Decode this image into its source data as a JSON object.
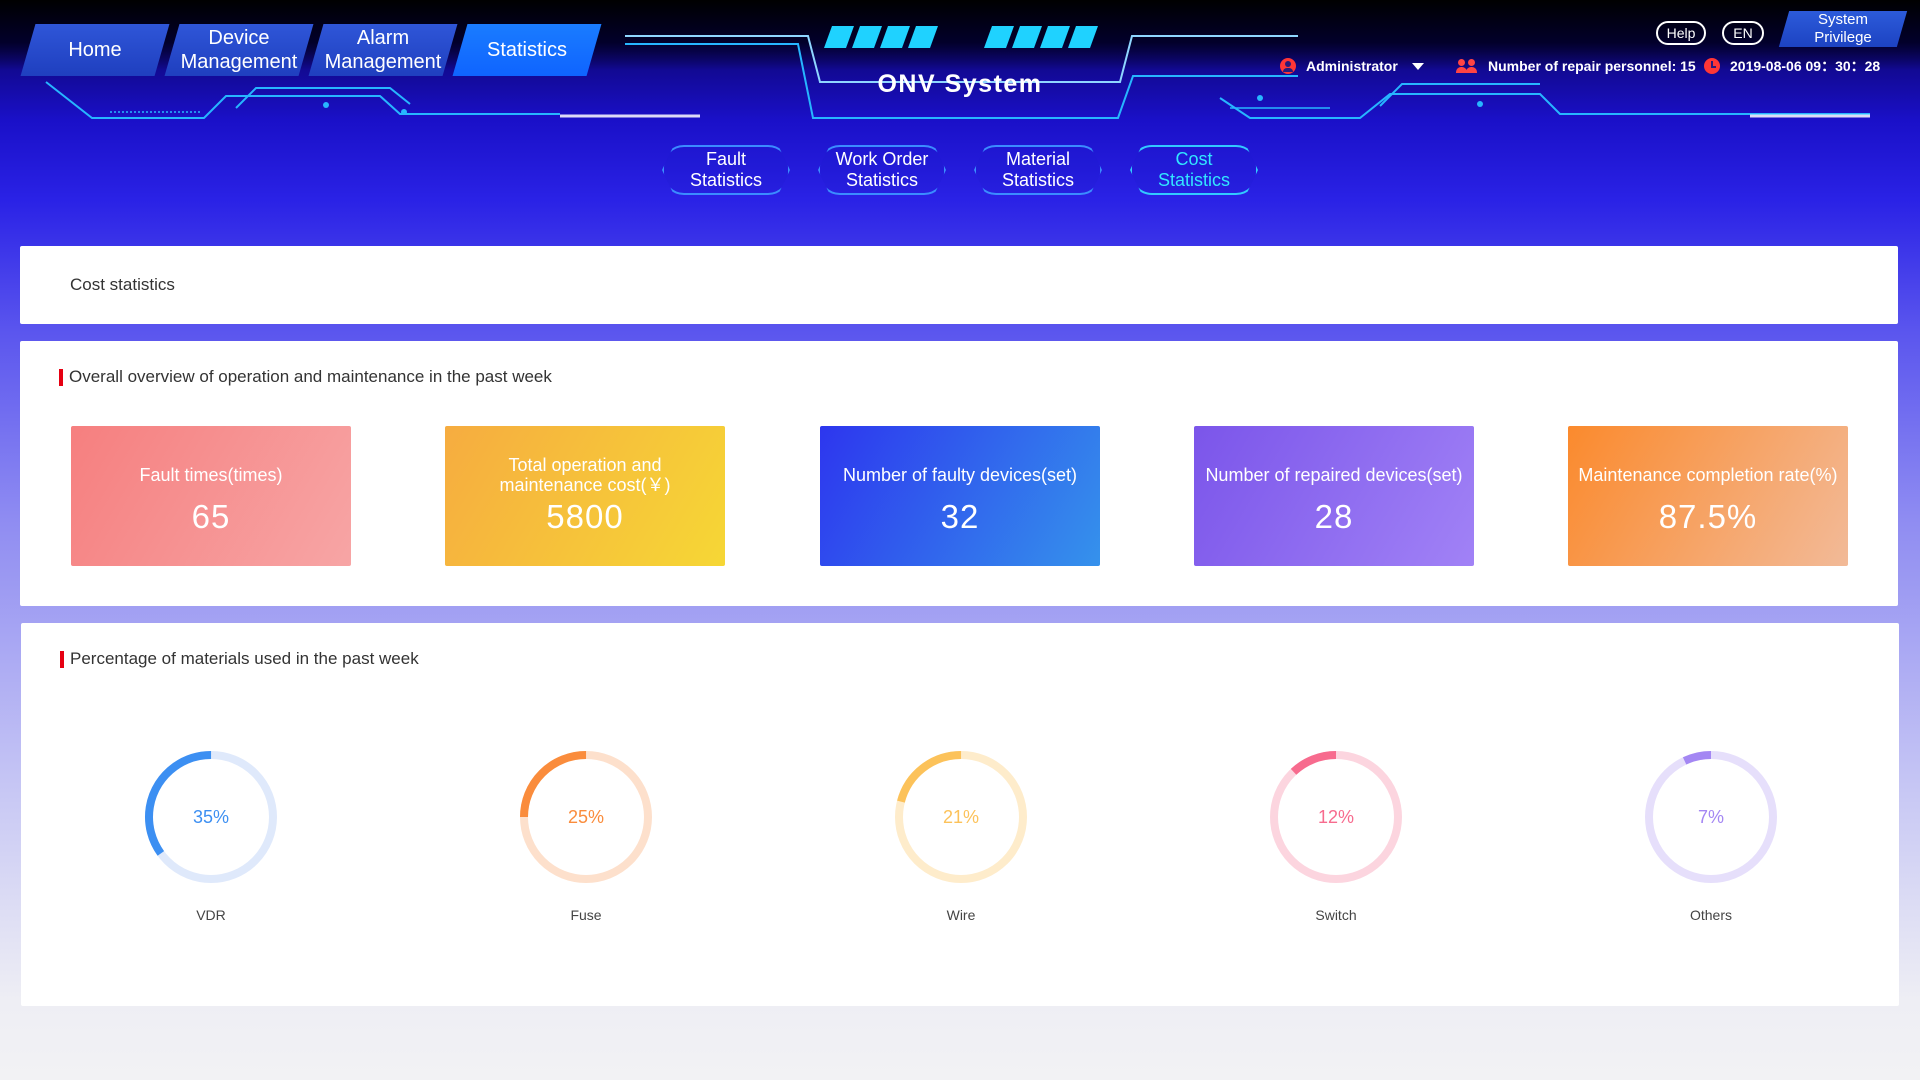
{
  "header": {
    "title": "ONV System",
    "nav": [
      {
        "label": "Home",
        "active": false
      },
      {
        "label": "Device\nManagement",
        "active": false
      },
      {
        "label": "Alarm\nManagement",
        "active": false
      },
      {
        "label": "Statistics",
        "active": true
      }
    ],
    "help_label": "Help",
    "language_label": "EN",
    "privilege_label": "System\nPrivilege",
    "user_label": "Administrator",
    "repair_personnel_label": "Number of repair personnel: 15",
    "datetime": "2019-08-06 09：30：28"
  },
  "sub_tabs": [
    {
      "label": "Fault\nStatistics",
      "active": false
    },
    {
      "label": "Work Order\nStatistics",
      "active": false
    },
    {
      "label": "Material\nStatistics",
      "active": false
    },
    {
      "label": "Cost\nStatistics",
      "active": true
    }
  ],
  "page_heading": "Cost statistics",
  "overview": {
    "title": "Overall overview of operation and maintenance in the past week",
    "cards": [
      {
        "label": "Fault times(times)",
        "value": "65",
        "colors": [
          "#f67f7f",
          "#f7a5a5"
        ]
      },
      {
        "label": "Total operation and maintenance cost(￥)",
        "value": "5800",
        "colors": [
          "#f6ac40",
          "#f6d735"
        ]
      },
      {
        "label": "Number of faulty devices(set)",
        "value": "32",
        "colors": [
          "#2d36ee",
          "#3592ec"
        ]
      },
      {
        "label": "Number of repaired devices(set)",
        "value": "28",
        "colors": [
          "#7b55ea",
          "#a182f6"
        ]
      },
      {
        "label": "Maintenance completion rate(%)",
        "value": "87.5%",
        "colors": [
          "#fb8a2d",
          "#f2ba98"
        ]
      }
    ]
  },
  "materials": {
    "title": "Percentage of materials used in the past week",
    "items": [
      {
        "name": "VDR",
        "percent": 35,
        "label": "35%",
        "color": "#3c8ff2",
        "track": "#dfe9fb"
      },
      {
        "name": "Fuse",
        "percent": 25,
        "label": "25%",
        "color": "#fa8c3c",
        "track": "#fde0cc"
      },
      {
        "name": "Wire",
        "percent": 21,
        "label": "21%",
        "color": "#fcc25a",
        "track": "#feeccb"
      },
      {
        "name": "Switch",
        "percent": 12,
        "label": "12%",
        "color": "#f76b8e",
        "track": "#fcd5df"
      },
      {
        "name": "Others",
        "percent": 7,
        "label": "7%",
        "color": "#a487f3",
        "track": "#e6dffb"
      }
    ]
  }
}
